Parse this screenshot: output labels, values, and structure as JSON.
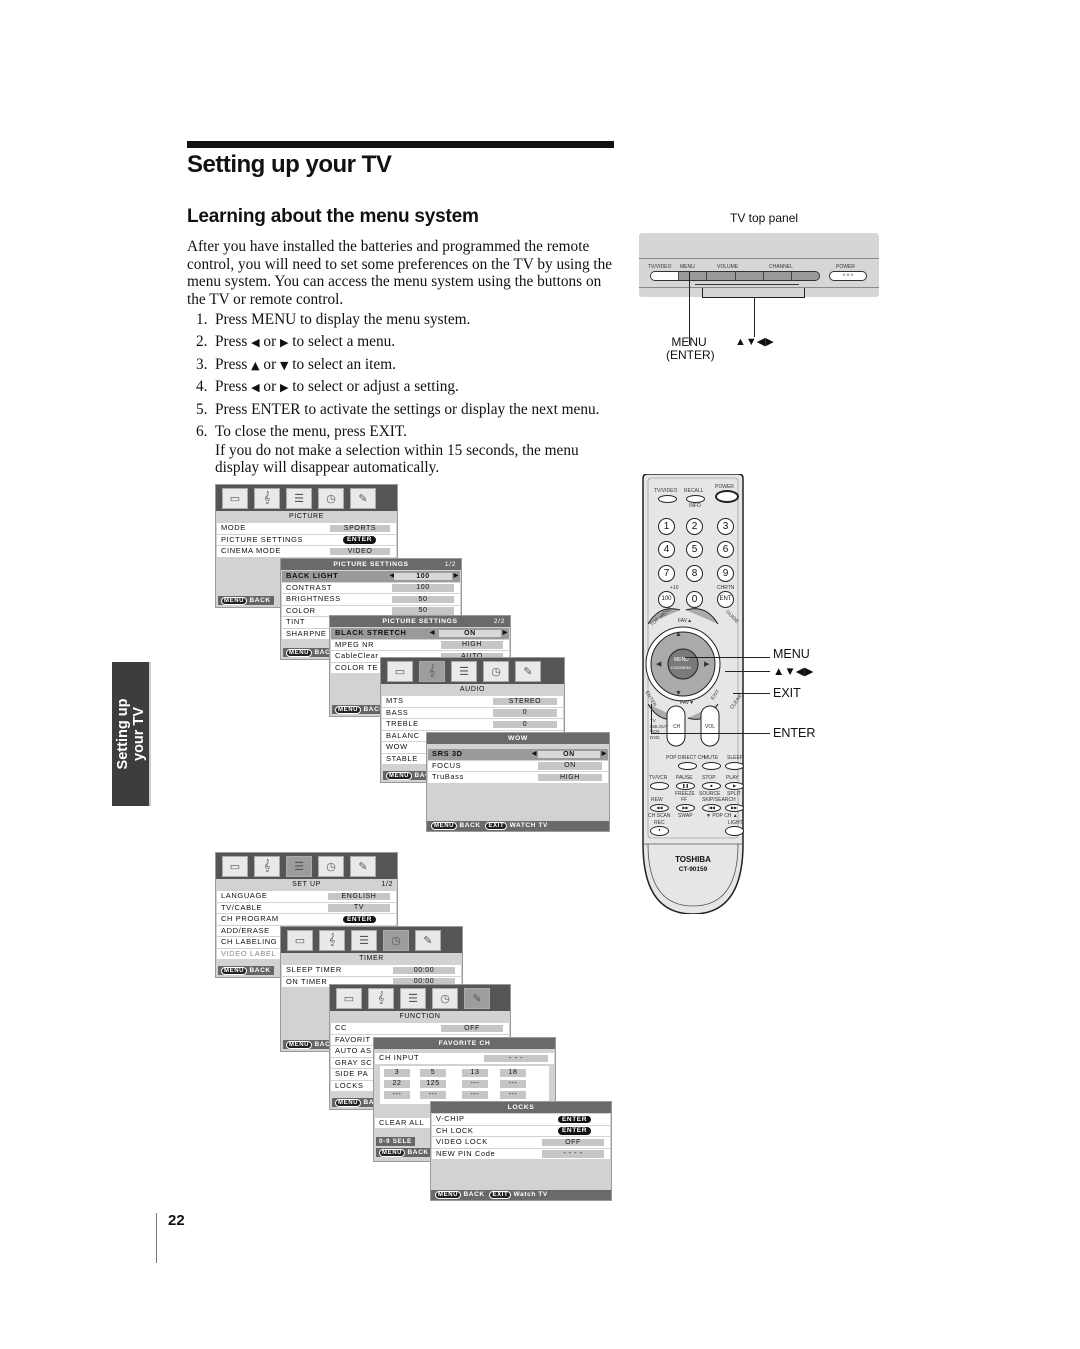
{
  "page": {
    "chapter_title": "Setting up your TV",
    "section_title": "Learning about the menu system",
    "intro": "After you have installed the batteries and programmed the remote control, you will need to set some preferences on the TV by using the menu system. You can access the menu system using the buttons on the TV or remote control.",
    "steps": [
      {
        "num": "1.",
        "pre": "Press MENU to display the menu system.",
        "sym1": "",
        "mid": "",
        "sym2": "",
        "post": ""
      },
      {
        "num": "2.",
        "pre": "Press ",
        "sym1": "◀",
        "mid": " or ",
        "sym2": "▶",
        "post": " to select a menu."
      },
      {
        "num": "3.",
        "pre": "Press ",
        "sym1": "▲",
        "mid": " or ",
        "sym2": "▼",
        "post": " to select an item."
      },
      {
        "num": "4.",
        "pre": "Press ",
        "sym1": "◀",
        "mid": " or ",
        "sym2": "▶",
        "post": " to select or adjust a setting."
      },
      {
        "num": "5.",
        "pre": "Press ENTER to activate the settings or display the next menu.",
        "sym1": "",
        "mid": "",
        "sym2": "",
        "post": ""
      },
      {
        "num": "6.",
        "pre": "To close the menu, press EXIT.",
        "sym1": "",
        "mid": "",
        "sym2": "",
        "post": ""
      }
    ],
    "step6_note": "If you do not make a selection within 15 seconds, the menu display will disappear automatically.",
    "side_tab": {
      "line1": "Setting up",
      "line2": "your TV"
    },
    "page_number": "22"
  },
  "tv_panel": {
    "caption": "TV top panel",
    "labels": {
      "tvvideo": "TV/VIDEO",
      "menu": "MENU",
      "volume": "VOLUME",
      "channel": "CHANNEL",
      "power": "POWER"
    },
    "callout_menu": "MENU",
    "callout_enter": "(ENTER)",
    "callout_arrows": "▲▼◀▶"
  },
  "icons": [
    "picture-icon",
    "audio-icon",
    "setup-icon",
    "timer-icon",
    "function-icon"
  ],
  "common": {
    "menu_key": "MENU",
    "exit_key": "EXIT",
    "back": "BACK",
    "watch_tv": "WATCH TV",
    "watch_tv_alt": "Watch TV",
    "enter": "ENTER"
  },
  "menus": {
    "picture": {
      "title": "PICTURE",
      "rows": [
        {
          "label": "MODE",
          "value": "SPORTS"
        },
        {
          "label": "PICTURE SETTINGS",
          "value": "ENTER"
        },
        {
          "label": "CINEMA MODE",
          "value": "VIDEO"
        }
      ]
    },
    "picture_settings_1": {
      "title": "PICTURE SETTINGS",
      "page": "1/2",
      "rows": [
        {
          "label": "BACK LIGHT",
          "value": "100"
        },
        {
          "label": "CONTRAST",
          "value": "100"
        },
        {
          "label": "BRIGHTNESS",
          "value": "50"
        },
        {
          "label": "COLOR",
          "value": "50"
        },
        {
          "label": "TINT",
          "value": ""
        },
        {
          "label": "SHARPNE",
          "value": ""
        }
      ]
    },
    "picture_settings_2": {
      "title": "PICTURE SETTINGS",
      "page": "2/2",
      "rows": [
        {
          "label": "BLACK STRETCH",
          "value": "ON"
        },
        {
          "label": "MPEG NR",
          "value": "HIGH"
        },
        {
          "label": "CableClear",
          "value": "AUTO"
        },
        {
          "label": "COLOR TE",
          "value": ""
        }
      ]
    },
    "audio": {
      "title": "AUDIO",
      "rows": [
        {
          "label": "MTS",
          "value": "STEREO"
        },
        {
          "label": "BASS",
          "value": "0"
        },
        {
          "label": "TREBLE",
          "value": "0"
        },
        {
          "label": "BALANC",
          "value": ""
        },
        {
          "label": "WOW",
          "value": ""
        },
        {
          "label": "STABLE",
          "value": ""
        }
      ]
    },
    "wow": {
      "title": "WOW",
      "rows": [
        {
          "label": "SRS 3D",
          "value": "ON"
        },
        {
          "label": "FOCUS",
          "value": "ON"
        },
        {
          "label": "TruBass",
          "value": "HIGH"
        }
      ]
    },
    "setup": {
      "title": "SET UP",
      "page": "1/2",
      "rows": [
        {
          "label": "LANGUAGE",
          "value": "ENGLISH"
        },
        {
          "label": "TV/CABLE",
          "value": "TV"
        },
        {
          "label": "CH PROGRAM",
          "value": "ENTER"
        },
        {
          "label": "ADD/ERASE",
          "value": ""
        },
        {
          "label": "CH LABELING",
          "value": ""
        },
        {
          "label": "VIDEO LABEL",
          "value": ""
        }
      ]
    },
    "timer": {
      "title": "TIMER",
      "rows": [
        {
          "label": "SLEEP TIMER",
          "value": "00:00"
        },
        {
          "label": "ON TIMER",
          "value": "00:00"
        }
      ]
    },
    "function": {
      "title": "FUNCTION",
      "rows": [
        {
          "label": "CC",
          "value": "OFF"
        },
        {
          "label": "FAVORIT",
          "value": ""
        },
        {
          "label": "AUTO AS",
          "value": ""
        },
        {
          "label": "GRAY SC",
          "value": ""
        },
        {
          "label": "SIDE PA",
          "value": ""
        },
        {
          "label": "LOCKS",
          "value": ""
        }
      ]
    },
    "favorite_ch": {
      "title": "FAVORITE CH",
      "ch_input_label": "CH INPUT",
      "ch_input_value": "- - -",
      "grid": [
        [
          "3",
          "5",
          "13",
          "18"
        ],
        [
          "22",
          "125",
          "---",
          "---"
        ],
        [
          "---",
          "---",
          "---",
          "---"
        ]
      ],
      "clear_all": "CLEAR ALL",
      "select_hint": "0-9 SELE"
    },
    "locks": {
      "title": "LOCKS",
      "rows": [
        {
          "label": "V-CHIP",
          "value": "ENTER"
        },
        {
          "label": "CH LOCK",
          "value": "ENTER"
        },
        {
          "label": "VIDEO LOCK",
          "value": "OFF"
        },
        {
          "label": "NEW PIN Code",
          "value": "- - - -"
        }
      ]
    }
  },
  "remote": {
    "top_buttons": {
      "tvvideo": "TV/VIDEO",
      "recall": "RECALL",
      "info": "INFO",
      "power": "POWER"
    },
    "numbers": [
      "1",
      "2",
      "3",
      "4",
      "5",
      "6",
      "7",
      "8",
      "9",
      "100",
      "0",
      "ENT"
    ],
    "plus10": "+10",
    "chrtn": "CHRTN",
    "top_menu": "TOP MENU",
    "guide": "GUIDE",
    "fav_up": "FAV▲",
    "fav_down": "FAV▼",
    "center": "MENU",
    "center_sub": "DVDMENU",
    "enter": "ENTER",
    "exit": "EXIT",
    "clear": "CLEAR",
    "ch": "CH",
    "vol": "VOL",
    "modes": [
      "TV",
      "CBL/SAT",
      "VCR",
      "DVD"
    ],
    "row_labels": [
      "POP DIRECT CH",
      "MUTE",
      "SLEEP"
    ],
    "transport_top": [
      "TV/VCR",
      "PAUSE",
      "STOP",
      "PLAY"
    ],
    "transport_sub": [
      "",
      "FREEZE",
      "SOURCE",
      "SPLIT"
    ],
    "transport2_top": [
      "REW",
      "FF",
      "SKIP/SEARCH",
      ""
    ],
    "transport2_sub": [
      "CH SCAN",
      "SWAP",
      "▼ POP CH ▲",
      ""
    ],
    "rec": "REC",
    "light": "LIGHT",
    "brand": "TOSHIBA",
    "model": "CT-90159",
    "callouts": {
      "menu": "MENU",
      "arrows": "▲▼◀▶",
      "exit": "EXIT",
      "enter": "ENTER"
    }
  }
}
